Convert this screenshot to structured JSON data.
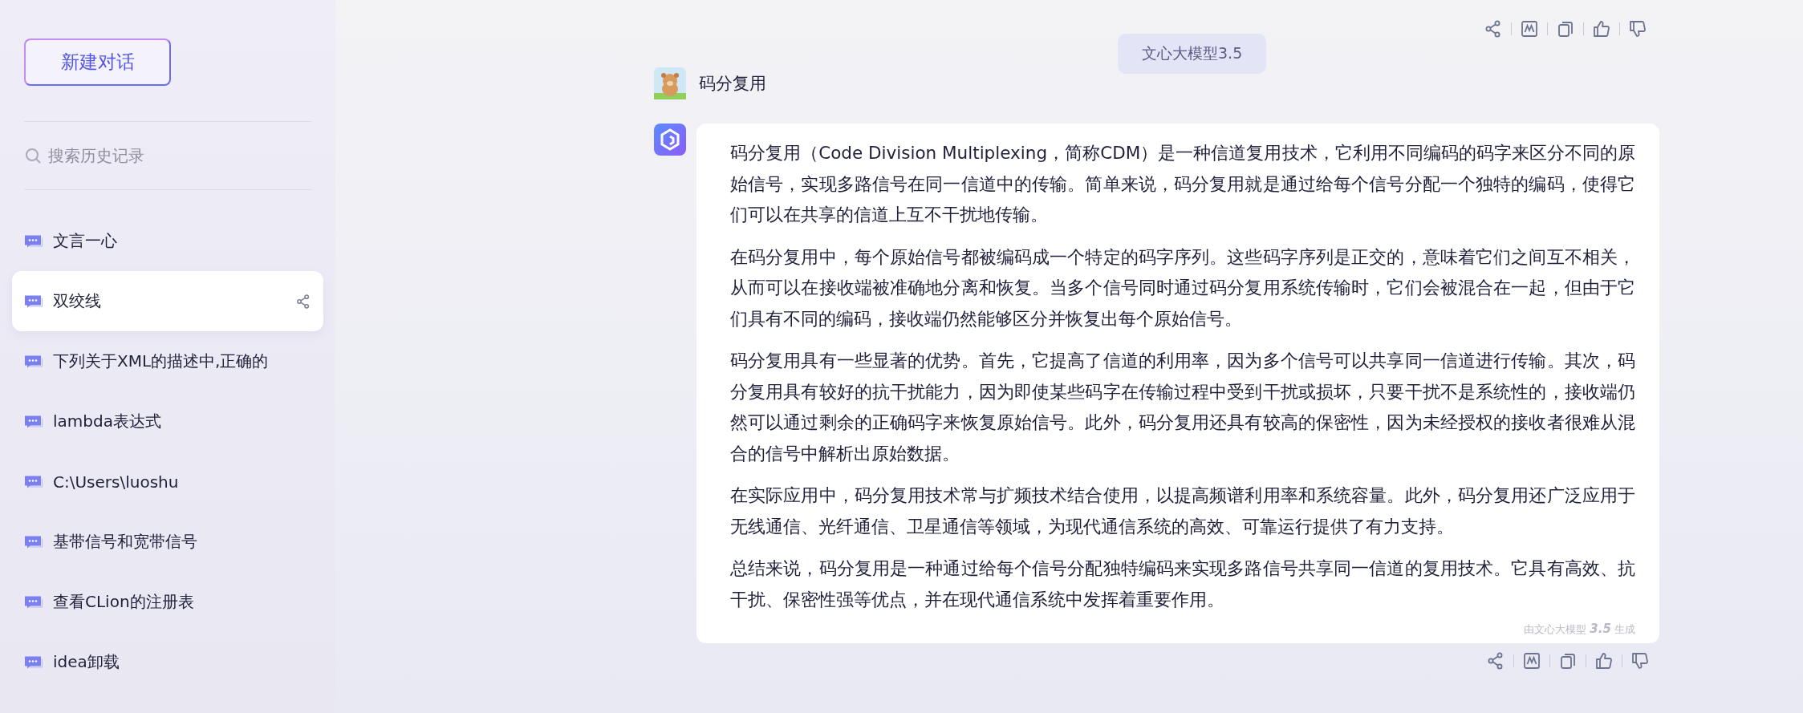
{
  "sidebar": {
    "new_chat_button": "新建对话",
    "search": {
      "placeholder": "搜索历史记录"
    },
    "items": [
      {
        "label": "文言一心",
        "selected": false
      },
      {
        "label": "双绞线",
        "selected": true
      },
      {
        "label": "下列关于XML的描述中,正确的",
        "selected": false
      },
      {
        "label": "lambda表达式",
        "selected": false
      },
      {
        "label": "C:\\Users\\luoshu",
        "selected": false
      },
      {
        "label": "基带信号和宽带信号",
        "selected": false
      },
      {
        "label": "查看CLion的注册表",
        "selected": false
      },
      {
        "label": "idea卸载",
        "selected": false
      }
    ]
  },
  "model_badge": "文心大模型3.5",
  "user_message": "码分复用",
  "reply": {
    "paragraphs": [
      "码分复用（Code Division Multiplexing，简称CDM）是一种信道复用技术，它利用不同编码的码字来区分不同的原始信号，实现多路信号在同一信道中的传输。简单来说，码分复用就是通过给每个信号分配一个独特的编码，使得它们可以在共享的信道上互不干扰地传输。",
      "在码分复用中，每个原始信号都被编码成一个特定的码字序列。这些码字序列是正交的，意味着它们之间互不相关，从而可以在接收端被准确地分离和恢复。当多个信号同时通过码分复用系统传输时，它们会被混合在一起，但由于它们具有不同的编码，接收端仍然能够区分并恢复出每个原始信号。",
      "码分复用具有一些显著的优势。首先，它提高了信道的利用率，因为多个信号可以共享同一信道进行传输。其次，码分复用具有较好的抗干扰能力，因为即使某些码字在传输过程中受到干扰或损坏，只要干扰不是系统性的，接收端仍然可以通过剩余的正确码字来恢复原始信号。此外，码分复用还具有较高的保密性，因为未经授权的接收者很难从混合的信号中解析出原始数据。",
      "在实际应用中，码分复用技术常与扩频技术结合使用，以提高频谱利用率和系统容量。此外，码分复用还广泛应用于无线通信、光纤通信、卫星通信等领域，为现代通信系统的高效、可靠运行提供了有力支持。",
      "总结来说，码分复用是一种通过给每个信号分配独特编码来实现多路信号共享同一信道的复用技术。它具有高效、抗干扰、保密性强等优点，并在现代通信系统中发挥着重要作用。"
    ],
    "footer": "由文心大模型 **3.5** 生成"
  }
}
